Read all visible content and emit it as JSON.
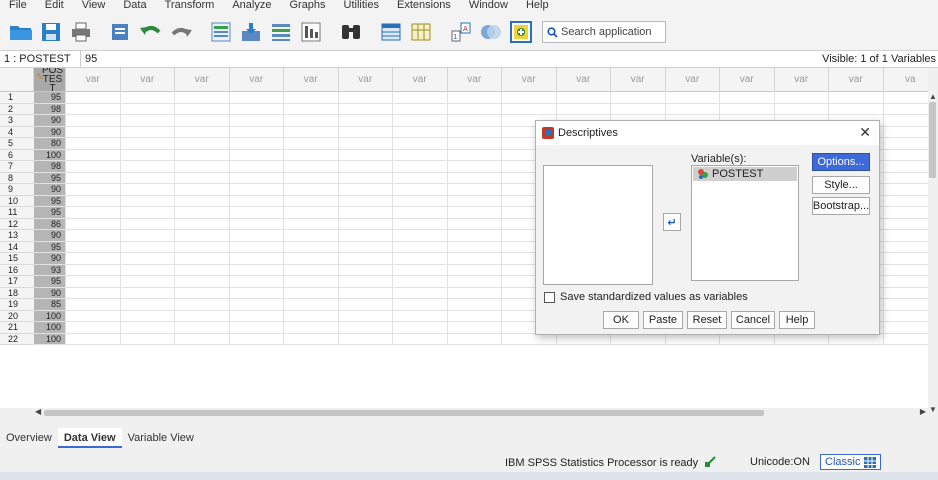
{
  "menu": [
    "File",
    "Edit",
    "View",
    "Data",
    "Transform",
    "Analyze",
    "Graphs",
    "Utilities",
    "Extensions",
    "Window",
    "Help"
  ],
  "toolbar": {
    "search_placeholder": "Search application",
    "icons": [
      "open-folder-icon",
      "save-icon",
      "print-icon",
      "dialog-recall-icon",
      "undo-icon",
      "redo-icon",
      "goto-case-icon",
      "goto-variable-icon",
      "variables-icon",
      "run-descriptives-icon",
      "find-icon",
      "insert-cases-icon",
      "insert-variable-icon",
      "split-file-icon",
      "value-labels-icon",
      "use-sets-icon"
    ]
  },
  "cellbar": {
    "ref": "1 : POSTEST",
    "value": "95",
    "visible": "Visible: 1 of 1 Variables"
  },
  "grid": {
    "var_header": "POSTEST",
    "empty_header": "var",
    "empty_header_last": "va",
    "rows": [
      "1",
      "2",
      "3",
      "4",
      "5",
      "6",
      "7",
      "8",
      "9",
      "10",
      "11",
      "12",
      "13",
      "14",
      "15",
      "16",
      "17",
      "18",
      "19",
      "20",
      "21",
      "22"
    ],
    "values": [
      "95",
      "98",
      "90",
      "90",
      "80",
      "100",
      "98",
      "95",
      "90",
      "95",
      "95",
      "86",
      "90",
      "95",
      "90",
      "93",
      "95",
      "90",
      "85",
      "100",
      "100",
      "100"
    ]
  },
  "tabs": [
    "Overview",
    "Data View",
    "Variable View"
  ],
  "status": {
    "processor": "IBM SPSS Statistics Processor is ready",
    "unicode": "Unicode:ON",
    "classic": "Classic"
  },
  "dialog": {
    "title": "Descriptives",
    "variables_label": "Variable(s):",
    "selected_variable": "POSTEST",
    "checkbox_label": "Save standardized values as variables",
    "side_buttons": [
      "Options...",
      "Style...",
      "Bootstrap..."
    ],
    "bottom_buttons": [
      "OK",
      "Paste",
      "Reset",
      "Cancel",
      "Help"
    ]
  },
  "colors": {
    "accent": "#3d6ad6",
    "data_column": "#b5b5b5"
  }
}
